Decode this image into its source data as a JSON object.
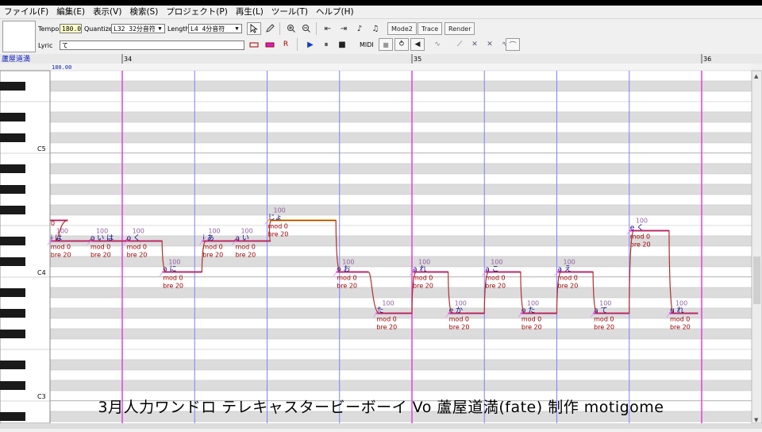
{
  "menu": [
    "ファイル(F)",
    "編集(E)",
    "表示(V)",
    "検索(S)",
    "プロジェクト(P)",
    "再生(L)",
    "ツール(T)",
    "ヘルプ(H)"
  ],
  "toolbar": {
    "tempo_label": "Tempo",
    "tempo_value": "180.0",
    "quantize_label": "Quantize",
    "quantize_value": "L32 32分音符",
    "length_label": "Length",
    "length_value": "L4  4分音符",
    "lyric_label": "Lyric",
    "lyric_value": "て",
    "midi_label": "MIDI",
    "mode2_label": "Mode2",
    "trace_label": "Trace",
    "render_label": "Render"
  },
  "track_name": "蘆屋道満",
  "tempo_marker": "180.00",
  "measures": [
    {
      "label": "34",
      "beat": 0
    },
    {
      "label": "35",
      "beat": 4
    },
    {
      "label": "36",
      "beat": 8
    }
  ],
  "piano_labels": [
    {
      "label": "C5",
      "pitch": 72
    },
    {
      "label": "C4",
      "pitch": 60
    },
    {
      "label": "C3",
      "pitch": 48
    }
  ],
  "notes": [
    {
      "lyric": "i は",
      "pitch": 63,
      "start": 0.0,
      "len": 0.55,
      "vel": "100",
      "mod": "mod 0",
      "bre": "bre 20"
    },
    {
      "lyric": "o い は",
      "pitch": 63,
      "start": 0.55,
      "len": 0.5,
      "vel": "100",
      "mod": "mod 0",
      "bre": "bre 20"
    },
    {
      "lyric": "o く",
      "pitch": 63,
      "start": 1.05,
      "len": 0.5,
      "vel": "100",
      "mod": "mod 0",
      "bre": "bre 20"
    },
    {
      "lyric": "o に",
      "pitch": 60,
      "start": 1.55,
      "len": 0.55,
      "vel": "100",
      "mod": "mod 0",
      "bre": "bre 20"
    },
    {
      "lyric": "i あ",
      "pitch": 63,
      "start": 2.1,
      "len": 0.45,
      "vel": "100",
      "mod": "mod 0",
      "bre": "bre 20"
    },
    {
      "lyric": "a い",
      "pitch": 63,
      "start": 2.55,
      "len": 0.5,
      "vel": "100",
      "mod": "mod 0",
      "bre": "bre 20"
    },
    {
      "lyric": "じょ",
      "pitch": 65,
      "start": 3.0,
      "len": 0.95,
      "vel": "100",
      "mod": "mod 0",
      "bre": "bre 20"
    },
    {
      "lyric": "o お",
      "pitch": 60,
      "start": 3.95,
      "len": 0.45,
      "vel": "100",
      "mod": "mod 0",
      "bre": "bre 20"
    },
    {
      "lyric": "た",
      "pitch": 56,
      "start": 4.5,
      "len": 0.5,
      "vel": "100",
      "mod": "mod 0",
      "bre": "bre 20"
    },
    {
      "lyric": "a れ",
      "pitch": 60,
      "start": 5.0,
      "len": 0.5,
      "vel": "100",
      "mod": "mod 0",
      "bre": "bre 20"
    },
    {
      "lyric": "e か",
      "pitch": 56,
      "start": 5.5,
      "len": 0.5,
      "vel": "100",
      "mod": "mod 0",
      "bre": "bre 20"
    },
    {
      "lyric": "a こ",
      "pitch": 60,
      "start": 6.0,
      "len": 0.5,
      "vel": "100",
      "mod": "mod 0",
      "bre": "bre 20"
    },
    {
      "lyric": "o た",
      "pitch": 56,
      "start": 6.5,
      "len": 0.5,
      "vel": "100",
      "mod": "mod 0",
      "bre": "bre 20"
    },
    {
      "lyric": "a え",
      "pitch": 60,
      "start": 7.0,
      "len": 0.5,
      "vel": "100",
      "mod": "mod 0",
      "bre": "bre 20"
    },
    {
      "lyric": "a て",
      "pitch": 56,
      "start": 7.5,
      "len": 0.5,
      "vel": "100",
      "mod": "mod 0",
      "bre": "bre 20"
    },
    {
      "lyric": "e く",
      "pitch": 64,
      "start": 8.0,
      "len": 0.55,
      "vel": "100",
      "mod": "mod 0",
      "bre": "bre 20"
    },
    {
      "lyric": "u れ",
      "pitch": 56,
      "start": 8.55,
      "len": 0.4,
      "vel": "100",
      "mod": "mod 0",
      "bre": "bre 20"
    }
  ],
  "subtitle": "3月人力ワンドロ  テレキャスタービーボーイ  Vo 蘆屋道満(fate)  制作 motigome",
  "colors": {
    "note": "#d020d0",
    "pitch_curve": "#b03030",
    "measure_line": "#e040e0",
    "beat_line": "#8080ff",
    "lyric_text": "#000080",
    "param_text": "#a00000",
    "vel_text": "#9060a0",
    "selected_note": "#f0e060"
  },
  "vel_partial_left": "0"
}
